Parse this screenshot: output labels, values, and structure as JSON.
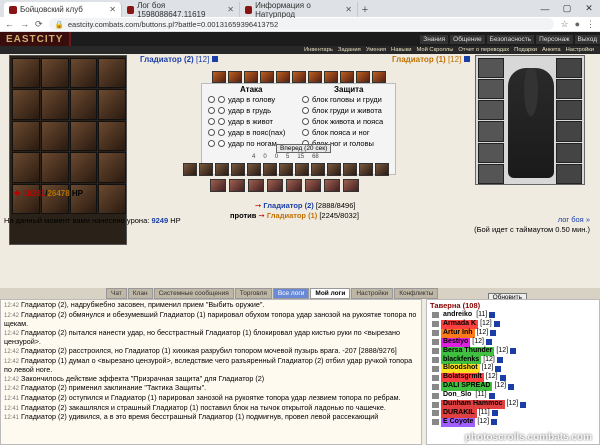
{
  "browser": {
    "tabs": [
      {
        "title": "Бойцовский клуб",
        "active": true
      },
      {
        "title": "Лог боя 1598088647.11619",
        "active": false
      },
      {
        "title": "Информация о Натурпрод",
        "active": false
      }
    ],
    "url": "eastcity.combats.com/buttons.pl?battle=0.00131659396413752"
  },
  "site": {
    "logo": "EASTCITY",
    "top_nav": [
      "Знания",
      "Общение",
      "Безопасность",
      "Персонаж",
      "Выход"
    ],
    "sub_nav": [
      "Инвентарь",
      "Задания",
      "Умения",
      "Навыки",
      "Мой Скроллы",
      "Отчет о переводах",
      "Подарки",
      "Анкета",
      "Настройки"
    ]
  },
  "fight": {
    "player1": {
      "name": "Гладиатор",
      "num": "(2)",
      "level": "[12]",
      "hp_current": "16281",
      "hp_max": "26478",
      "hp_unit": "HP"
    },
    "player2": {
      "name": "Гладиатор",
      "num": "(1)",
      "level": "[12]"
    },
    "attack_header": "Атака",
    "defense_header": "Защита",
    "attacks": [
      "удар в голову",
      "удар в грудь",
      "удар в живот",
      "удар в пояс(пах)",
      "удар по ногам"
    ],
    "defenses": [
      "блок головы и груди",
      "блок груди и живота",
      "блок живота и пояса",
      "блок пояса и ног",
      "блок ног и головы"
    ],
    "forward_button": "Вперед (20 сек)",
    "effects": [
      "4",
      "0",
      "0",
      "5",
      "15",
      "68"
    ],
    "p2_name": "Гладиатор (2)",
    "p2_hp": "[2888/8496]",
    "vs_label": "против",
    "p1_name": "Гладиатор (1)",
    "p1_hp": "[2245/8032]",
    "damage_label": "На данный момент вами нанесено урона:",
    "damage_value": "9249",
    "damage_unit": "HP",
    "log_link": "лог боя »",
    "timeout_text": "(Бой идет с таймаутом 0.50 мин.)"
  },
  "chat_tabs": [
    "Чат",
    "Клан",
    "Системные сообщения",
    "Торговля",
    "Все логи",
    "Мой логи",
    "Настройки",
    "Конфликты"
  ],
  "chat": [
    {
      "time": "12:42",
      "text": "Гладиатор (2), надрубжебно засовен, применил прием \"Выбить оружие\"."
    },
    {
      "time": "12:42",
      "text": "Гладиатор (2) обмянулся и обезумевший Гладиатор (1) парировал обухом топора удар занозой на рукоятке топора по щекам."
    },
    {
      "time": "12:42",
      "text": "Гладиатор (2) пытался нанести удар, но бесстрастный Гладиатор (1) блокировал удар кистью руки по <вырезано цензурой>."
    },
    {
      "time": "12:42",
      "text": "Гладиатор (2) расстроился, но Гладиатор (1) хихикая разрубил топором мочевой пузырь врага. -207 [2888/9276]"
    },
    {
      "time": "12:42",
      "text": "Гладиатор (1) думал о <вырезано цензурой>, вследствие чего разъяренный Гладиатор (2) отбил удар ручкой топора по левой ноге."
    },
    {
      "time": "12:42",
      "text": "Закончилось действие эффекта \"Призрачная защита\" для Гладиатор (2)"
    },
    {
      "time": "12:42",
      "text": "Гладиатор (2) применил заклинание \"Тактика Защиты\"."
    },
    {
      "time": "12:41",
      "text": "Гладиатор (2) оступился и Гладиатор (1) парировал занозой на рукоятке топора удар лезвием топора по ребрам."
    },
    {
      "time": "12:41",
      "text": "Гладиатор (2) закашлялся и страшный Гладиатор (1) поставил блок на тычок открытой ладонью по чашечке."
    },
    {
      "time": "12:41",
      "text": "Гладиатор (2) удивился, а в это время бесстрашный Гладиатор (1) подмигнув, провел левой рассекающий"
    }
  ],
  "tavern": {
    "title": "Таверна (108)",
    "refresh": "Обновить",
    "users": [
      {
        "name": "andreiko",
        "level": "[11]",
        "color": "#ffffff"
      },
      {
        "name": "Armada K",
        "level": "[12]",
        "color": "#ff4040"
      },
      {
        "name": "Artur Inh",
        "level": "[12]",
        "color": "#ff7a1a"
      },
      {
        "name": "Bestiyo",
        "level": "[12]",
        "color": "#e020e0"
      },
      {
        "name": "Bersa Thunder",
        "level": "[12]",
        "color": "#40c040"
      },
      {
        "name": "blackfenks",
        "level": "[12]",
        "color": "#40c040"
      },
      {
        "name": "Bloodshot",
        "level": "[12]",
        "color": "#ffe020"
      },
      {
        "name": "Bolatsgrmlt",
        "level": "[12]",
        "color": "#ff4040"
      },
      {
        "name": "DALI SPREAD",
        "level": "[12]",
        "color": "#40c040"
      },
      {
        "name": "Don_Slo",
        "level": "[11]",
        "color": "#ffffff"
      },
      {
        "name": "Dunham Hammoc",
        "level": "[12]",
        "color": "#e04040"
      },
      {
        "name": "DURAKIL",
        "level": "[11]",
        "color": "#e04040"
      },
      {
        "name": "E Coyote",
        "level": "[12]",
        "color": "#a060ff"
      }
    ]
  },
  "watermark": "photoscrolls.combats.com"
}
